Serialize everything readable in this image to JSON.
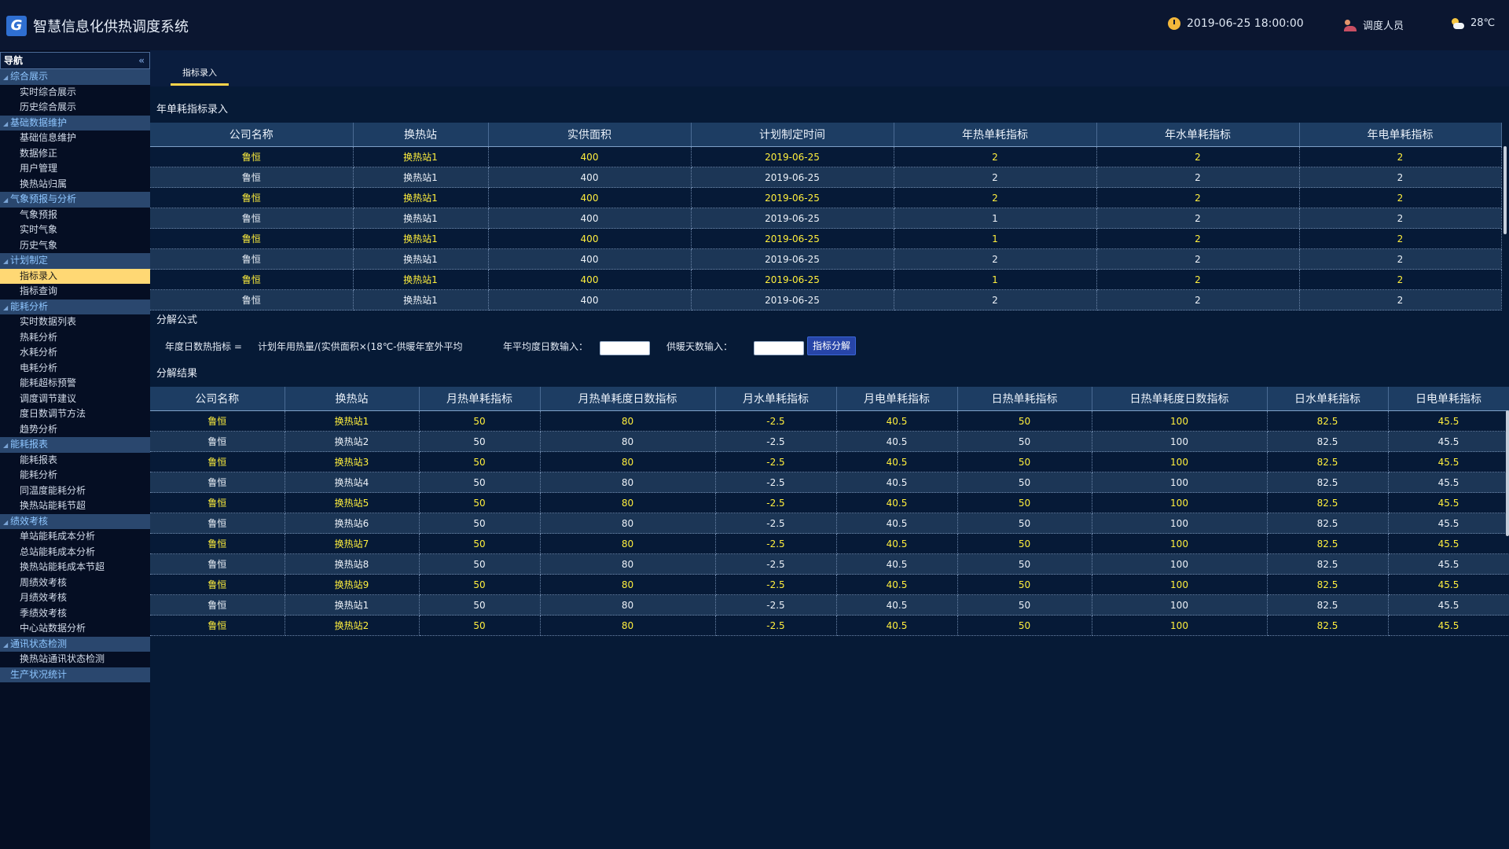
{
  "app": {
    "title": "智慧信息化供热调度系统",
    "logo_char": "G"
  },
  "topbar": {
    "datetime": "2019-06-25 18:00:00",
    "user": "调度人员",
    "temperature": "28℃"
  },
  "nav": {
    "title": "导航",
    "groups": [
      {
        "label": "综合展示",
        "items": [
          "实时综合展示",
          "历史综合展示"
        ]
      },
      {
        "label": "基础数据维护",
        "items": [
          "基础信息维护",
          "数据修正",
          "用户管理",
          "换热站归属"
        ]
      },
      {
        "label": "气象预报与分析",
        "items": [
          "气象预报",
          "实时气象",
          "历史气象"
        ]
      },
      {
        "label": "计划制定",
        "items": [
          "指标录入",
          "指标查询"
        ]
      },
      {
        "label": "能耗分析",
        "items": [
          "实时数据列表",
          "热耗分析",
          "水耗分析",
          "电耗分析",
          "能耗超标预警",
          "调度调节建议",
          "度日数调节方法",
          "趋势分析"
        ]
      },
      {
        "label": "能耗报表",
        "items": [
          "能耗报表",
          "能耗分析",
          "同温度能耗分析",
          "换热站能耗节超"
        ]
      },
      {
        "label": "绩效考核",
        "items": [
          "单站能耗成本分析",
          "总站能耗成本分析",
          "换热站能耗成本节超",
          "周绩效考核",
          "月绩效考核",
          "季绩效考核",
          "中心站数据分析"
        ]
      },
      {
        "label": "通讯状态检测",
        "items": [
          "换热站通讯状态检测"
        ]
      },
      {
        "label": "生产状况统计",
        "items": []
      }
    ],
    "active_item": "指标录入"
  },
  "tab": {
    "label": "指标录入"
  },
  "annual": {
    "title": "年单耗指标录入",
    "columns": [
      "公司名称",
      "换热站",
      "实供面积",
      "计划制定时间",
      "年热单耗指标",
      "年水单耗指标",
      "年电单耗指标"
    ],
    "rows": [
      [
        "鲁恒",
        "换热站1",
        "400",
        "2019-06-25",
        "2",
        "2",
        "2"
      ],
      [
        "鲁恒",
        "换热站1",
        "400",
        "2019-06-25",
        "2",
        "2",
        "2"
      ],
      [
        "鲁恒",
        "换热站1",
        "400",
        "2019-06-25",
        "2",
        "2",
        "2"
      ],
      [
        "鲁恒",
        "换热站1",
        "400",
        "2019-06-25",
        "1",
        "2",
        "2"
      ],
      [
        "鲁恒",
        "换热站1",
        "400",
        "2019-06-25",
        "1",
        "2",
        "2"
      ],
      [
        "鲁恒",
        "换热站1",
        "400",
        "2019-06-25",
        "2",
        "2",
        "2"
      ],
      [
        "鲁恒",
        "换热站1",
        "400",
        "2019-06-25",
        "1",
        "2",
        "2"
      ],
      [
        "鲁恒",
        "换热站1",
        "400",
        "2019-06-25",
        "2",
        "2",
        "2"
      ]
    ]
  },
  "formula": {
    "title": "分解公式",
    "label": "年度日数热指标 =",
    "expression": "计划年用热量/(实供面积×(18℃-供暖年室外平均",
    "avg_label": "年平均度日数输入：",
    "avg_value": "",
    "days_label": "供暖天数输入：",
    "days_value": "",
    "button": "指标分解"
  },
  "result": {
    "title": "分解结果",
    "columns": [
      "公司名称",
      "换热站",
      "月热单耗指标",
      "月热单耗度日数指标",
      "月水单耗指标",
      "月电单耗指标",
      "日热单耗指标",
      "日热单耗度日数指标",
      "日水单耗指标",
      "日电单耗指标"
    ],
    "rows": [
      [
        "鲁恒",
        "换热站1",
        "50",
        "80",
        "-2.5",
        "40.5",
        "50",
        "100",
        "82.5",
        "45.5"
      ],
      [
        "鲁恒",
        "换热站2",
        "50",
        "80",
        "-2.5",
        "40.5",
        "50",
        "100",
        "82.5",
        "45.5"
      ],
      [
        "鲁恒",
        "换热站3",
        "50",
        "80",
        "-2.5",
        "40.5",
        "50",
        "100",
        "82.5",
        "45.5"
      ],
      [
        "鲁恒",
        "换热站4",
        "50",
        "80",
        "-2.5",
        "40.5",
        "50",
        "100",
        "82.5",
        "45.5"
      ],
      [
        "鲁恒",
        "换热站5",
        "50",
        "80",
        "-2.5",
        "40.5",
        "50",
        "100",
        "82.5",
        "45.5"
      ],
      [
        "鲁恒",
        "换热站6",
        "50",
        "80",
        "-2.5",
        "40.5",
        "50",
        "100",
        "82.5",
        "45.5"
      ],
      [
        "鲁恒",
        "换热站7",
        "50",
        "80",
        "-2.5",
        "40.5",
        "50",
        "100",
        "82.5",
        "45.5"
      ],
      [
        "鲁恒",
        "换热站8",
        "50",
        "80",
        "-2.5",
        "40.5",
        "50",
        "100",
        "82.5",
        "45.5"
      ],
      [
        "鲁恒",
        "换热站9",
        "50",
        "80",
        "-2.5",
        "40.5",
        "50",
        "100",
        "82.5",
        "45.5"
      ],
      [
        "鲁恒",
        "换热站1",
        "50",
        "80",
        "-2.5",
        "40.5",
        "50",
        "100",
        "82.5",
        "45.5"
      ],
      [
        "鲁恒",
        "换热站2",
        "50",
        "80",
        "-2.5",
        "40.5",
        "50",
        "100",
        "82.5",
        "45.5"
      ]
    ]
  }
}
